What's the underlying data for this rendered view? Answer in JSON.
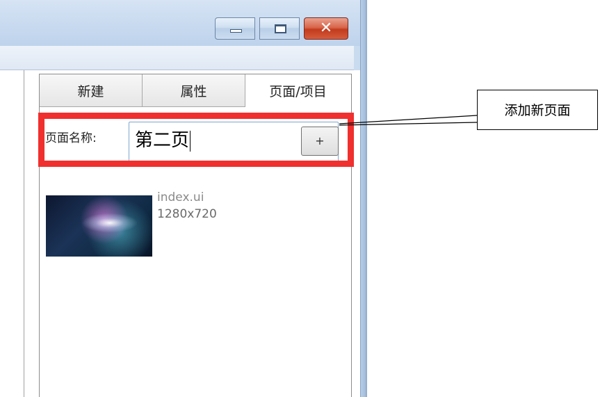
{
  "window": {
    "controls": {
      "minimize_icon": "minimize-icon",
      "maximize_icon": "maximize-icon",
      "close_icon": "close-icon",
      "close_glyph": "✕"
    }
  },
  "tabs": [
    {
      "label": "新建"
    },
    {
      "label": "属性"
    },
    {
      "label": "页面/项目"
    }
  ],
  "new_page": {
    "label": "页面名称:",
    "value": "第二页",
    "add_button": "+"
  },
  "pages": [
    {
      "name": "index.ui",
      "size": "1280x720"
    }
  ],
  "annotation": {
    "text": "添加新页面",
    "highlight_color": "#f0302e"
  }
}
